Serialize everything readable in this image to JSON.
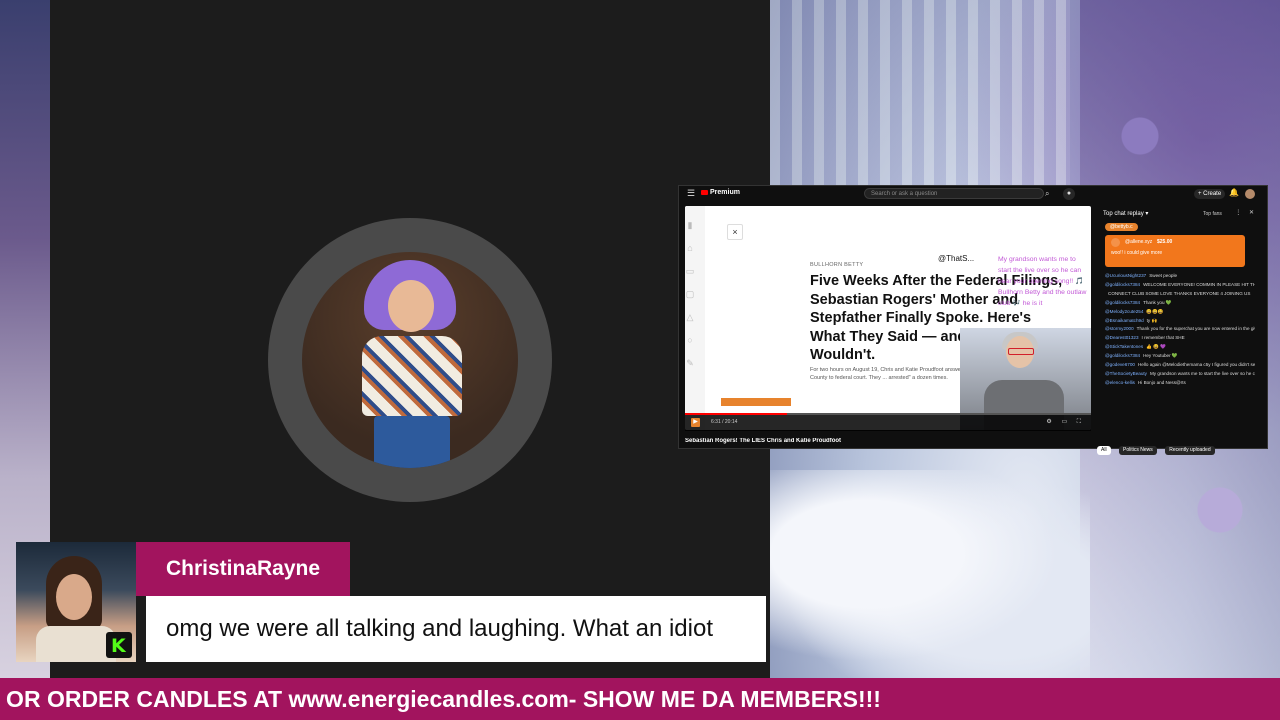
{
  "youtube": {
    "logo": "Premium",
    "search_placeholder": "Search or ask a question",
    "create_label": "Create",
    "video_title": "Sebastian Rogers! The LIES Chris and Katie Proudfoot",
    "tags": [
      "All",
      "Politics News",
      "Recently uploaded"
    ],
    "progress": 0.25,
    "time": "6:31 / 20:14"
  },
  "article": {
    "kicker": "BULLHORN BETTY",
    "headline": "Five Weeks After the Federal Filings, Sebastian Rogers' Mother and Stepfather Finally Spoke. Here's What They Said — and What They Wouldn't.",
    "body": "For two hours on August 19, Chris and Katie Proudfoot answered ... time since Seth Rogers took Sumner County to federal court. They ... arrested\" a dozen times.",
    "handle": "@ThatS...",
    "overlay_chat": "My grandson wants me to start the live over so he can hear your opening song!! 🎵 Bullhorn Betty and the outlaw club 🎶 he is it"
  },
  "chat": {
    "header": "Top chat replay",
    "sort": "Top fans",
    "pill": "@bettyb.c",
    "superchat": {
      "name": "@allene.xyz",
      "amount": "$25.00",
      "message": "woo!! i could give more"
    },
    "lines": [
      {
        "user": "@UcuriousNight237",
        "text": "Sweet people"
      },
      {
        "user": "@goldilocks7384",
        "text": "WELCOME EVERYONE! COMMIN IN PLEASE HIT THAT LIKE & SHOW BULLHORN BETTY"
      },
      {
        "user": "",
        "text": "CONNECT CLUB SOME LOVE THANKS EVERYONE 4 JOINING US"
      },
      {
        "user": "@goldilocks7384",
        "text": "Thank you 💚"
      },
      {
        "user": "@Melody2cute254",
        "text": "😄😄😄"
      },
      {
        "user": "@Bsnaikamatch9d",
        "text": "ty 🙌"
      },
      {
        "user": "@stormy2000",
        "text": "Thank you for the superchat you are now entered in the giveaway"
      },
      {
        "user": "@Dearest01323",
        "text": "I remember that SHE"
      },
      {
        "user": "@StickTakentones",
        "text": "👍 😆 💜"
      },
      {
        "user": "@goldilocks7384",
        "text": "Hey Youtuber 💚"
      },
      {
        "user": "@godeve6700",
        "text": "Hello again @Melodiethemama c5y I figured you didn't see me say hello when I came in. It was busy in here lol"
      },
      {
        "user": "@TheSocietyBeauty",
        "text": "My grandson wants me to start the live over so he can hear your opening song!! 🎵 Bullhorn Betty and the outlaw club 🎶 he is it"
      },
      {
        "user": "@elenco-kellis",
        "text": "Hi Bonjo and Ness@rts"
      }
    ]
  },
  "alert": {
    "username": "ChristinaRayne",
    "message": "omg we were all talking and laughing. What an idiot",
    "platform_badge": "K"
  },
  "ticker": {
    "text": "! OR ORDER CANDLES AT www.energiecandles.com- SHOW ME DA MEMBERS!!!"
  },
  "colors": {
    "brand_magenta": "#a2145e",
    "kick_green": "#53fc18",
    "youtube_red": "#ff0000",
    "accent_orange": "#e7832d"
  }
}
